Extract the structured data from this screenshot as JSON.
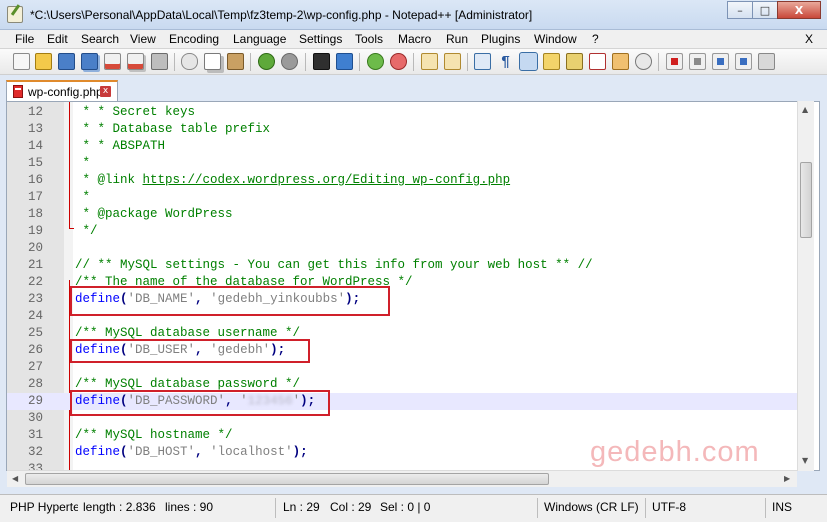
{
  "window": {
    "title": "*C:\\Users\\Personal\\AppData\\Local\\Temp\\fz3temp-2\\wp-config.php - Notepad++ [Administrator]",
    "minimize_glyph": "–",
    "maximize_glyph": "□",
    "close_glyph": "X"
  },
  "menu": {
    "items": [
      "File",
      "Edit",
      "Search",
      "View",
      "Encoding",
      "Language",
      "Settings",
      "Tools",
      "Macro",
      "Run",
      "Plugins",
      "Window",
      "?"
    ],
    "close_label": "X"
  },
  "toolbar": {
    "icons": [
      "new-file-icon",
      "open-file-icon",
      "save-icon",
      "save-all-icon",
      "close-icon",
      "close-all-icon",
      "print-icon",
      "cut-icon",
      "copy-icon",
      "paste-icon",
      "undo-icon",
      "redo-icon",
      "find-icon",
      "replace-icon",
      "zoom-in-icon",
      "zoom-out-icon",
      "sync-vertical-icon",
      "sync-horizontal-icon",
      "word-wrap-icon",
      "show-all-chars-icon",
      "indent-guide-icon",
      "user-language-icon",
      "doc-map-icon",
      "function-list-icon",
      "folder-as-workspace-icon",
      "monitoring-icon",
      "record-macro-icon",
      "stop-macro-icon",
      "play-macro-icon",
      "run-macro-multiple-icon",
      "save-macro-icon"
    ],
    "selected_icon": "indent-guide-icon"
  },
  "tab": {
    "label": "wp-config.php",
    "close_glyph": "x"
  },
  "editor": {
    "lines": [
      {
        "num": "12",
        "segments": [
          {
            "t": " * * Secret keys",
            "c": "cmt"
          }
        ]
      },
      {
        "num": "13",
        "segments": [
          {
            "t": " * * Database table prefix",
            "c": "cmt"
          }
        ]
      },
      {
        "num": "14",
        "segments": [
          {
            "t": " * * ABSPATH",
            "c": "cmt"
          }
        ]
      },
      {
        "num": "15",
        "segments": [
          {
            "t": " *",
            "c": "cmt"
          }
        ]
      },
      {
        "num": "16",
        "segments": [
          {
            "t": " * @link ",
            "c": "cmt"
          },
          {
            "t": "https://codex.wordpress.org/Editing_wp-config.php",
            "c": "url"
          }
        ]
      },
      {
        "num": "17",
        "segments": [
          {
            "t": " *",
            "c": "cmt"
          }
        ]
      },
      {
        "num": "18",
        "segments": [
          {
            "t": " * @package WordPress",
            "c": "cmt"
          }
        ]
      },
      {
        "num": "19",
        "segments": [
          {
            "t": " */",
            "c": "cmt"
          }
        ]
      },
      {
        "num": "20",
        "segments": []
      },
      {
        "num": "21",
        "segments": [
          {
            "t": "// ** MySQL settings - You can get this info from your web host ** //",
            "c": "cmt"
          }
        ]
      },
      {
        "num": "22",
        "segments": [
          {
            "t": "/** The name of the database for WordPress */",
            "c": "cmt"
          }
        ]
      },
      {
        "num": "23",
        "segments": [
          {
            "t": "define",
            "c": "kw"
          },
          {
            "t": "(",
            "c": "op"
          },
          {
            "t": "'DB_NAME'",
            "c": "str"
          },
          {
            "t": ", ",
            "c": "op"
          },
          {
            "t": "'gedebh_yinkoubbs'",
            "c": "str"
          },
          {
            "t": ");",
            "c": "op"
          }
        ]
      },
      {
        "num": "24",
        "segments": []
      },
      {
        "num": "25",
        "segments": [
          {
            "t": "/** MySQL database username */",
            "c": "cmt"
          }
        ]
      },
      {
        "num": "26",
        "segments": [
          {
            "t": "define",
            "c": "kw"
          },
          {
            "t": "(",
            "c": "op"
          },
          {
            "t": "'DB_USER'",
            "c": "str"
          },
          {
            "t": ", ",
            "c": "op"
          },
          {
            "t": "'gedebh'",
            "c": "str"
          },
          {
            "t": ");",
            "c": "op"
          }
        ]
      },
      {
        "num": "27",
        "segments": []
      },
      {
        "num": "28",
        "segments": [
          {
            "t": "/** MySQL database password */",
            "c": "cmt"
          }
        ]
      },
      {
        "num": "29",
        "segments": [
          {
            "t": "define",
            "c": "kw"
          },
          {
            "t": "(",
            "c": "op"
          },
          {
            "t": "'DB_PASSWORD'",
            "c": "str"
          },
          {
            "t": ", ",
            "c": "op"
          },
          {
            "t": "'",
            "c": "str"
          },
          {
            "t": "123456",
            "c": "blur"
          },
          {
            "t": "'",
            "c": "str"
          },
          {
            "t": ");",
            "c": "op"
          }
        ],
        "current": true
      },
      {
        "num": "30",
        "segments": []
      },
      {
        "num": "31",
        "segments": [
          {
            "t": "/** MySQL hostname */",
            "c": "cmt"
          }
        ]
      },
      {
        "num": "32",
        "segments": [
          {
            "t": "define",
            "c": "kw"
          },
          {
            "t": "(",
            "c": "op"
          },
          {
            "t": "'DB_HOST'",
            "c": "str"
          },
          {
            "t": ", ",
            "c": "op"
          },
          {
            "t": "'localhost'",
            "c": "str"
          },
          {
            "t": ");",
            "c": "op"
          }
        ]
      },
      {
        "num": "33",
        "segments": []
      }
    ],
    "highlight_color": "#d0202a"
  },
  "watermark": "gedebh.com",
  "status": {
    "language": "PHP Hyperte",
    "length": "length : 2.836",
    "lines": "lines : 90",
    "ln": "Ln : 29",
    "col": "Col : 29",
    "sel": "Sel : 0 | 0",
    "eol": "Windows (CR LF)",
    "encoding": "UTF-8",
    "mode": "INS"
  }
}
